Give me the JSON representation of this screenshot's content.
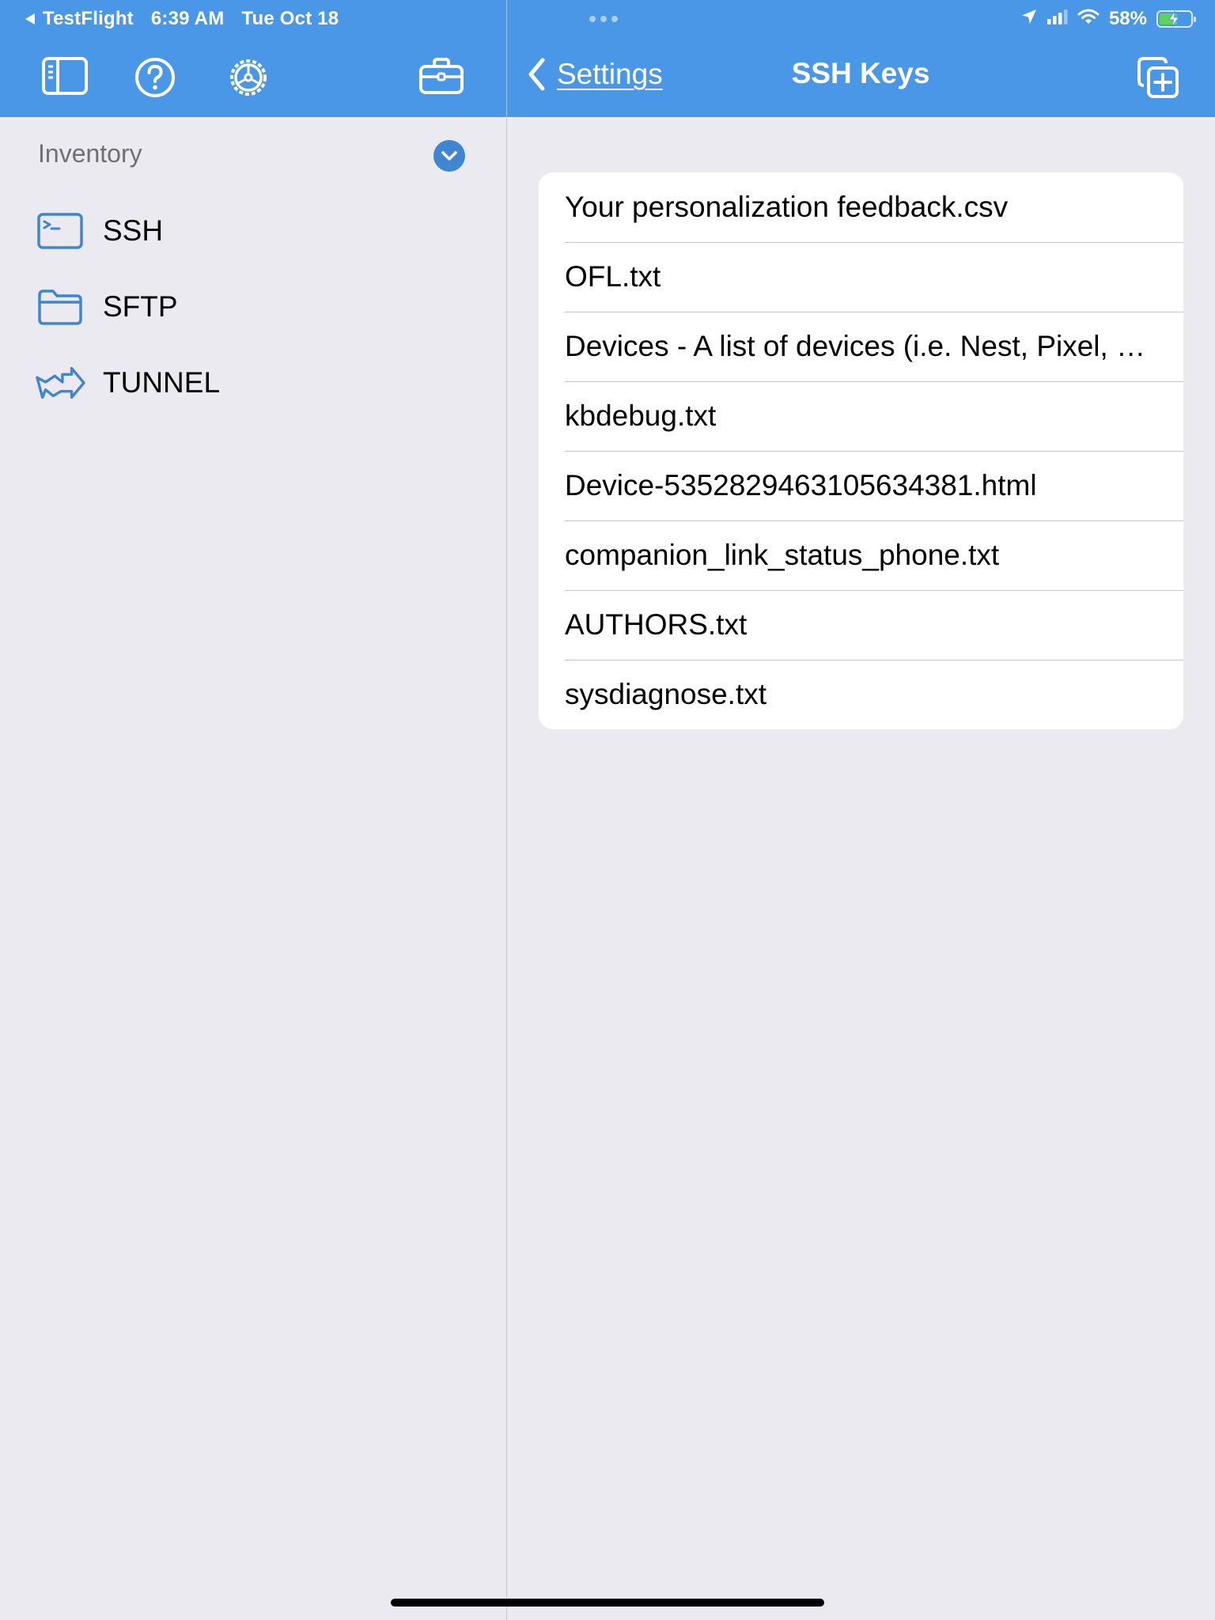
{
  "status_bar": {
    "back_app": "TestFlight",
    "time": "6:39 AM",
    "date": "Tue Oct 18",
    "battery_percent": "58%",
    "battery_level": 0.58,
    "charging": true
  },
  "toolbar": {
    "icons": [
      "sidebar-toggle-icon",
      "help-icon",
      "settings-gear-icon",
      "briefcase-icon"
    ]
  },
  "sidebar": {
    "section_title": "Inventory",
    "items": [
      {
        "label": "SSH",
        "icon": "terminal-icon"
      },
      {
        "label": "SFTP",
        "icon": "folder-icon"
      },
      {
        "label": "TUNNEL",
        "icon": "tunnel-arrow-icon"
      }
    ]
  },
  "nav": {
    "back_label": "Settings",
    "title": "SSH Keys",
    "action_icon": "add-copy-icon"
  },
  "files": [
    "Your personalization feedback.csv",
    "OFL.txt",
    "Devices - A list of devices (i.e. Nest, Pixel, Chromecast).html",
    "kbdebug.txt",
    "Device-5352829463105634381.html",
    "companion_link_status_phone.txt",
    "AUTHORS.txt",
    "sysdiagnose.txt"
  ],
  "colors": {
    "accent": "#4a97e7",
    "background": "#ebeaf0",
    "icon_blue": "#3f85d0"
  }
}
